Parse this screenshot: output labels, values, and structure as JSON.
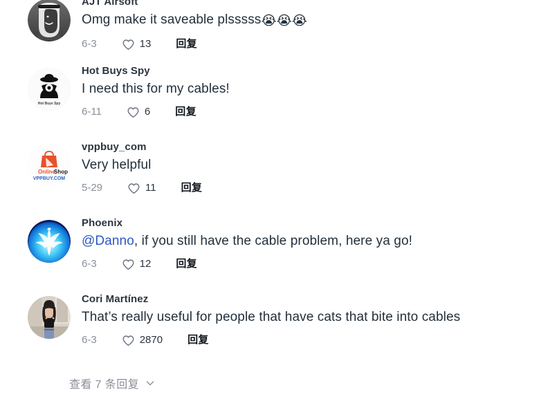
{
  "theme": {
    "background": "#ffffff",
    "username_color": "#2b3440",
    "text_color": "#22303c",
    "mention_color": "#2c57c6",
    "muted_color": "#8a8f98",
    "reply_color": "#11161c"
  },
  "comments": [
    {
      "username": "AJT Airsoft",
      "text": "Omg make it saveable plsssss",
      "emojis": "😭😭😭",
      "date": "6-3",
      "likes": "13",
      "reply_label": "回复",
      "avatar": "portrait-man-headscarf-avatar"
    },
    {
      "username": "Hot Buys Spy",
      "text": "I need this for my cables!",
      "emojis": "",
      "date": "6-11",
      "likes": "6",
      "reply_label": "回复",
      "avatar": "spy-detective-logo-avatar"
    },
    {
      "username": "vppbuy_com",
      "text": "Very helpful",
      "emojis": "",
      "date": "5-29",
      "likes": "11",
      "reply_label": "回复",
      "avatar": "onlineshop-vppbuy-logo-avatar"
    },
    {
      "username": "Phoenix",
      "text_mention": "@Danno",
      "text": ", if you still have the cable problem, here ya go!",
      "emojis": "",
      "date": "6-3",
      "likes": "12",
      "reply_label": "回复",
      "avatar": "blue-phoenix-logo-avatar"
    },
    {
      "username": "Cori Martínez",
      "text": "That’s really useful for people that have cats that bite into cables",
      "emojis": "",
      "date": "6-3",
      "likes": "2870",
      "reply_label": "回复",
      "avatar": "portrait-woman-avatar"
    }
  ],
  "footer": {
    "view_replies_label": "查看 7 条回复",
    "chevron_icon": "chevron-down-icon"
  }
}
